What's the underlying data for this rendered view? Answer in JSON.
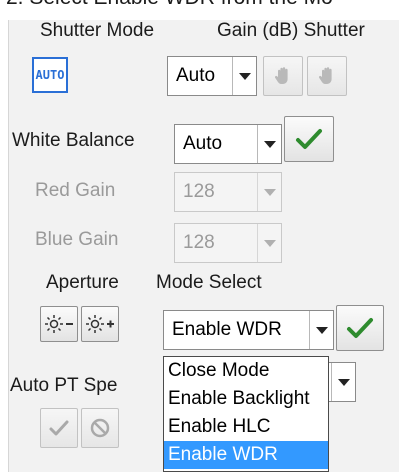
{
  "instruction_text": "2.    Select Enable WDR from the Mo",
  "shutter": {
    "mode_label": "Shutter Mode",
    "gain_label": "Gain (dB) Shutter",
    "auto_button_text": "AUTO",
    "combo_value": "Auto"
  },
  "white_balance": {
    "label": "White Balance",
    "combo_value": "Auto",
    "red_gain_label": "Red Gain",
    "red_gain_value": "128",
    "blue_gain_label": "Blue Gain",
    "blue_gain_value": "128"
  },
  "aperture": {
    "label": "Aperture",
    "minus_icon": "aperture-decrease-icon",
    "plus_icon": "aperture-increase-icon"
  },
  "mode_select": {
    "label": "Mode Select",
    "current_value": "Enable WDR",
    "options": [
      "Close Mode",
      "Enable Backlight",
      "Enable HLC",
      "Enable WDR"
    ],
    "selected_index": 3
  },
  "auto_pt": {
    "label": "Auto PT Spe"
  },
  "colors": {
    "accent": "#2a6fd6",
    "check_green": "#2e8b2e",
    "selection": "#3399ff"
  }
}
